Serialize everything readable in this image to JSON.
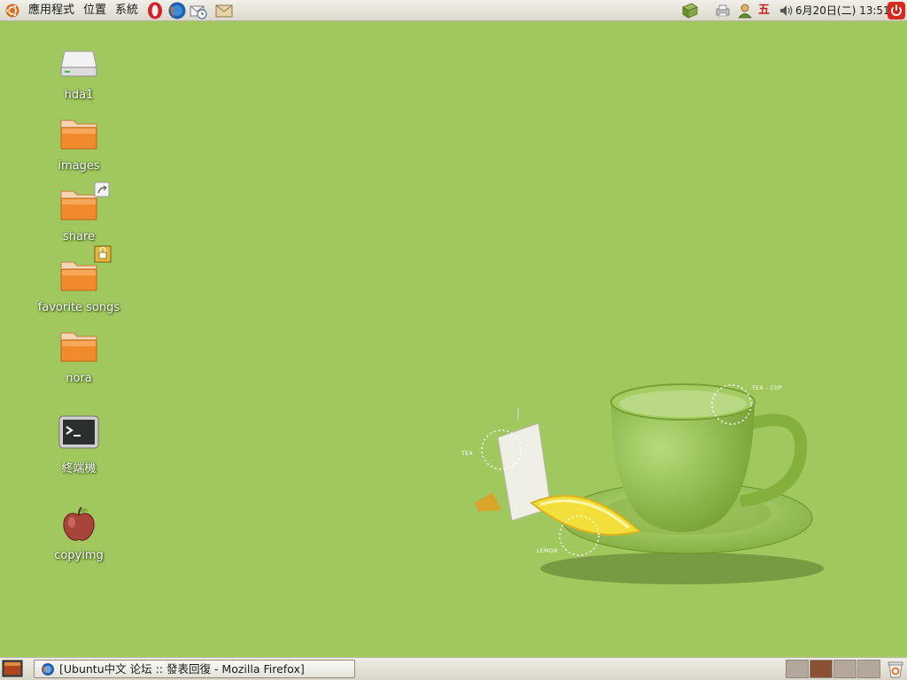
{
  "top_panel": {
    "menus": {
      "applications": "應用程式",
      "places": "位置",
      "system": "系統"
    },
    "launchers": [
      "opera-icon",
      "firefox-icon",
      "mail-clock-icon",
      "envelope-icon"
    ],
    "tray": {
      "input_method": "五",
      "clock": "6月20日(二) 13:51"
    }
  },
  "desktop": {
    "icons": [
      {
        "label": "hda1",
        "icon": "drive-icon"
      },
      {
        "label": "images",
        "icon": "folder-icon"
      },
      {
        "label": "share",
        "icon": "folder-icon"
      },
      {
        "label": "favorite songs",
        "icon": "folder-icon"
      },
      {
        "label": "nora",
        "icon": "folder-icon"
      },
      {
        "label": "終端機",
        "icon": "terminal-icon"
      },
      {
        "label": "copyimg",
        "icon": "apple-icon"
      }
    ],
    "wallpaper_labels": {
      "cup": "TEA - CUP",
      "tea": "TEA",
      "lemon": "LEMON"
    }
  },
  "bottom_panel": {
    "task_title": "[Ubuntu中文 论坛 :: 發表回復 - Mozilla Firefox]",
    "workspace_count": 4,
    "active_workspace": 2
  },
  "colors": {
    "desktop_bg": "#a0c85e",
    "panel_bg": "#e8e5dc",
    "folder_orange": "#f08a2c",
    "active_workspace": "#8a5232"
  }
}
